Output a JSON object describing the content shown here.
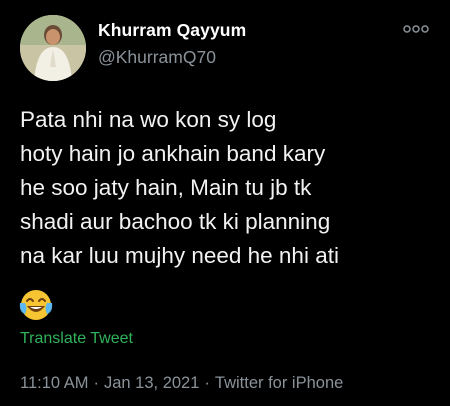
{
  "author": {
    "display_name": "Khurram Qayyum",
    "handle": "@KhurramQ70",
    "avatar_icon": "profile-photo"
  },
  "tweet": {
    "text": "Pata nhi na wo kon sy log\nhoty hain jo ankhain band kary\nhe soo jaty hain, Main tu jb tk\nshadi aur bachoo tk ki planning\nna kar luu mujhy need he nhi ati",
    "emoji": "face-with-tears-of-joy"
  },
  "translate_label": "Translate Tweet",
  "meta": {
    "time": "11:10 AM",
    "separator": "·",
    "date": "Jan 13, 2021",
    "source": "Twitter for iPhone"
  },
  "colors": {
    "background": "#000000",
    "text_primary": "#ffffff",
    "text_secondary": "#8a9299",
    "translate_link": "#2fb35a"
  }
}
